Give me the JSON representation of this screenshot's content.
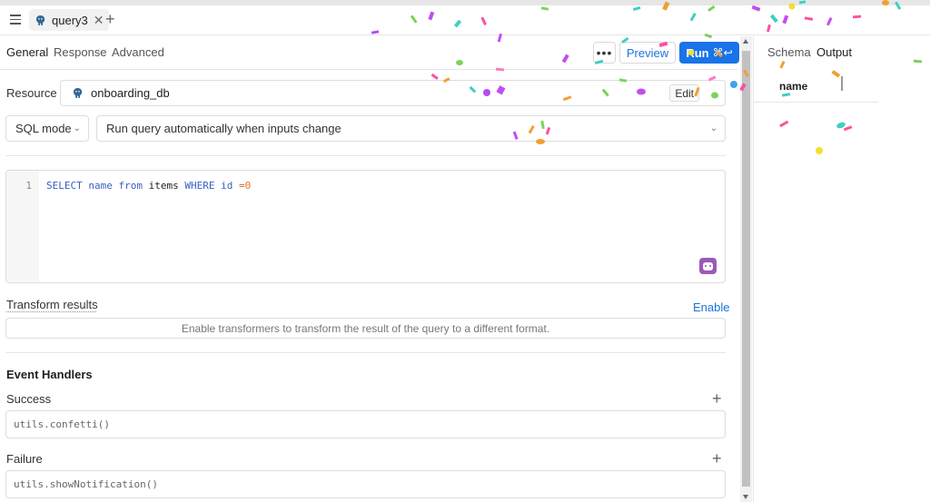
{
  "tab": {
    "label": "query3",
    "pg_icon": "postgres-elephant-icon"
  },
  "subtabs": {
    "general": "General",
    "response": "Response",
    "advanced": "Advanced"
  },
  "toolbar": {
    "more": "•••",
    "preview": "Preview",
    "run": "Run",
    "run_shortcut": "⌘↩"
  },
  "resource": {
    "label": "Resource",
    "name": "onboarding_db",
    "edit": "Edit"
  },
  "mode": {
    "value": "SQL mode"
  },
  "trigger": {
    "value": "Run query automatically when inputs change"
  },
  "editor": {
    "line": "1",
    "kw_select": "SELECT",
    "name": "name",
    "kw_from": "from",
    "table": "items",
    "kw_where": "WHERE",
    "col": "id",
    "op": "=",
    "val": "0"
  },
  "transform": {
    "label": "Transform results",
    "enable": "Enable",
    "info": "Enable transformers to transform the result of the query to a different format."
  },
  "events": {
    "title": "Event Handlers",
    "success_label": "Success",
    "success_value": "utils.confetti()",
    "failure_label": "Failure",
    "failure_value": "utils.showNotification()"
  },
  "right": {
    "schema": "Schema",
    "output": "Output",
    "column": "name"
  },
  "colors": {
    "accent": "#1a73e8",
    "ai": "#9b59b6"
  }
}
